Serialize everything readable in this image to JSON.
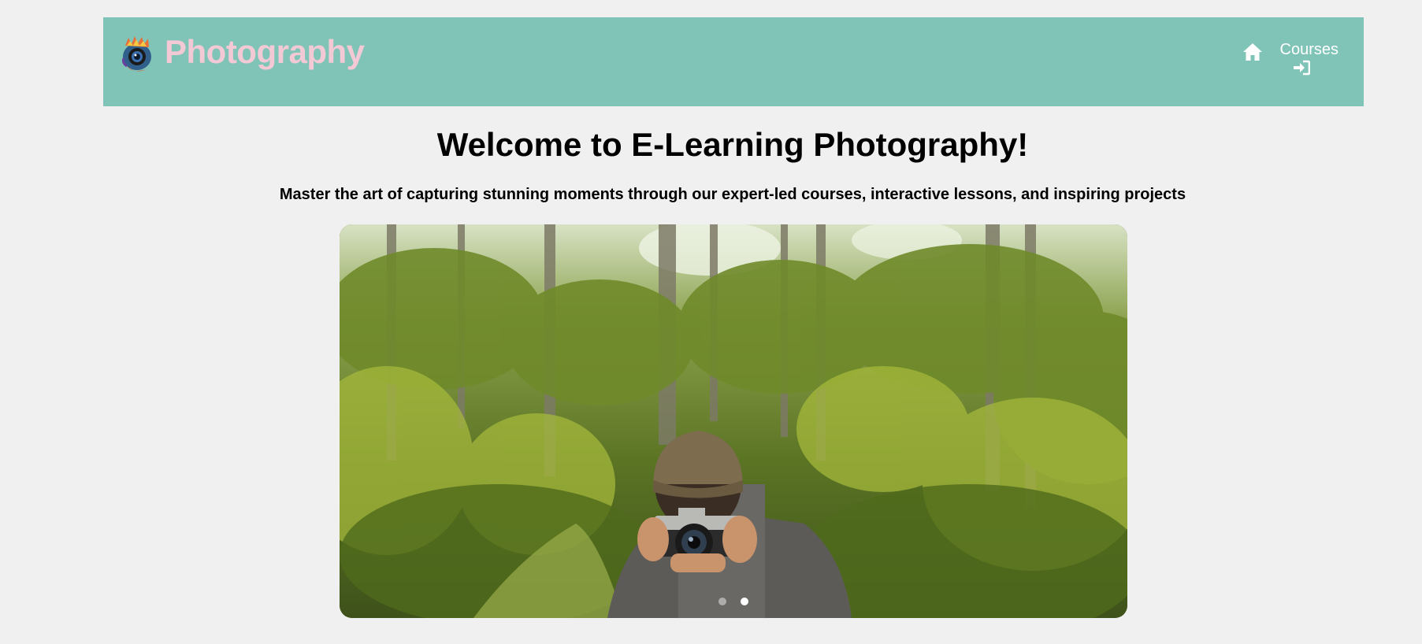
{
  "header": {
    "brand_title": "Photography",
    "logo_icon": "camera-mascot-logo",
    "bg_color": "#80c4b7",
    "title_color": "#f2c9d4"
  },
  "nav": {
    "home_icon": "home-icon",
    "courses_label": "Courses",
    "login_icon": "login-icon"
  },
  "hero": {
    "title": "Welcome to E-Learning Photography!",
    "subtitle": "Master the art of capturing stunning moments through our expert-led courses, interactive lessons, and inspiring projects"
  },
  "carousel": {
    "slide_count": 2,
    "active_index": 1
  }
}
